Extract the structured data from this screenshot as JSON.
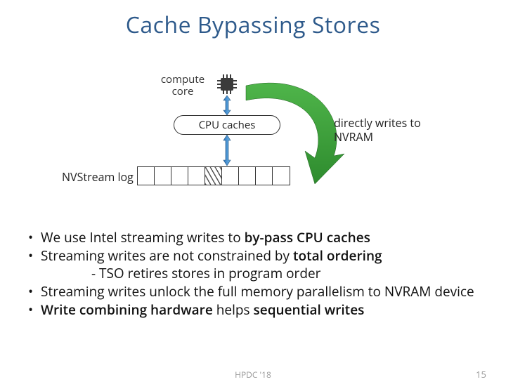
{
  "title": "Cache Bypassing Stores",
  "diagram": {
    "compute_core": "compute\ncore",
    "cpu_caches": "CPU caches",
    "annotation": "directly writes to\nNVRAM",
    "nvstream_log": "NVStream log",
    "log_cells": 9,
    "hatched_index": 4
  },
  "bullets": {
    "b1_pre": "We use Intel streaming writes to ",
    "b1_bold": "by-pass CPU caches",
    "b2_pre": "Streaming writes are not constrained by ",
    "b2_bold": "total ordering",
    "b2_sub": "- TSO retires stores in program order",
    "b3": "Streaming writes unlock the full memory parallelism to NVRAM device",
    "b4_bold1": "Write combining hardware",
    "b4_mid": " helps ",
    "b4_bold2": "sequential writes"
  },
  "footer": {
    "venue": "HPDC '18",
    "page": "15"
  }
}
